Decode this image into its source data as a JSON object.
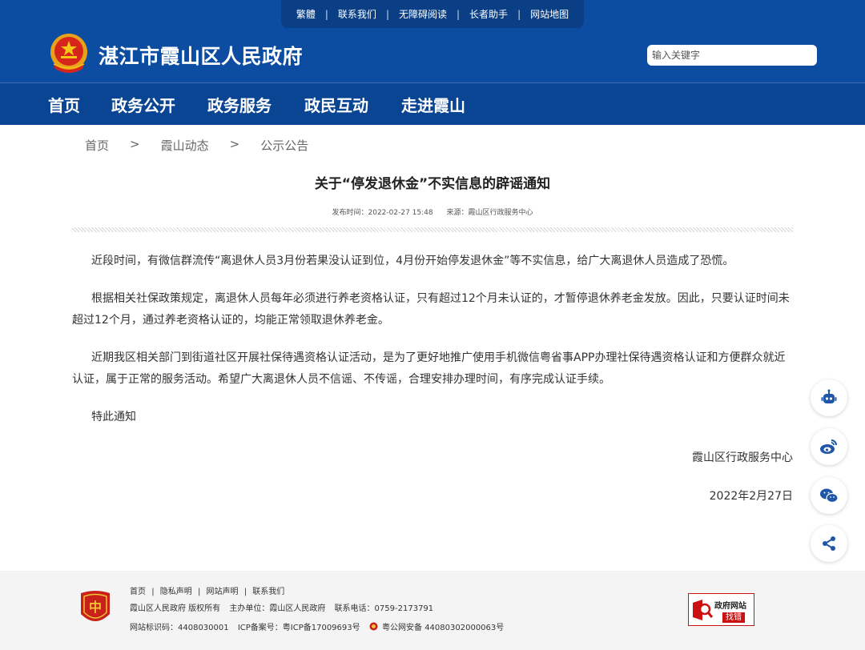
{
  "toplinks": [
    "繁體",
    "联系我们",
    "无障碍阅读",
    "长者助手",
    "网站地图"
  ],
  "site_title": "湛江市霞山区人民政府",
  "search": {
    "placeholder": "输入关键字"
  },
  "nav": [
    "首页",
    "政务公开",
    "政务服务",
    "政民互动",
    "走进霞山"
  ],
  "breadcrumb": {
    "items": [
      "首页",
      "霞山动态",
      "公示公告"
    ],
    "separator": ">"
  },
  "article": {
    "title": "关于“停发退休金”不实信息的辟谣通知",
    "publish_time": "发布时间：2022-02-27 15:48",
    "source": "来源：霞山区行政服务中心",
    "paragraphs": [
      "近段时间，有微信群流传“离退休人员3月份若果没认证到位，4月份开始停发退休金”等不实信息，给广大离退休人员造成了恐慌。",
      "根据相关社保政策规定，离退休人员每年必须进行养老资格认证，只有超过12个月未认证的，才暂停退休养老金发放。因此，只要认证时间未超过12个月，通过养老资格认证的，均能正常领取退休养老金。",
      "近期我区相关部门到街道社区开展社保待遇资格认证活动，是为了更好地推广使用手机微信粤省事APP办理社保待遇资格认证和方便群众就近认证，属于正常的服务活动。希望广大离退休人员不信谣、不传谣，合理安排办理时间，有序完成认证手续。",
      "特此通知"
    ],
    "signature": "霞山区行政服务中心",
    "date": "2022年2月27日"
  },
  "tools": [
    "robot-icon",
    "weibo-icon",
    "wechat-icon",
    "share-icon"
  ],
  "footer": {
    "links": [
      "首页",
      "|",
      "隐私声明",
      "|",
      "网站声明",
      "|",
      "联系我们"
    ],
    "copyright": "霞山区人民政府 版权所有",
    "sponsor": "主办单位：霞山区人民政府",
    "phone": "联系电话：0759-2173791",
    "site_code": "网站标识码：4408030001",
    "icp": "ICP备案号：粤ICP备17009693号",
    "police": "粤公网安备 44080302000063号",
    "find_error": {
      "title": "政府网站",
      "button": "找错"
    }
  },
  "colors": {
    "header_blue": "#0c4da2",
    "nav_blue": "#0a4594",
    "error_red": "#cc1111"
  }
}
